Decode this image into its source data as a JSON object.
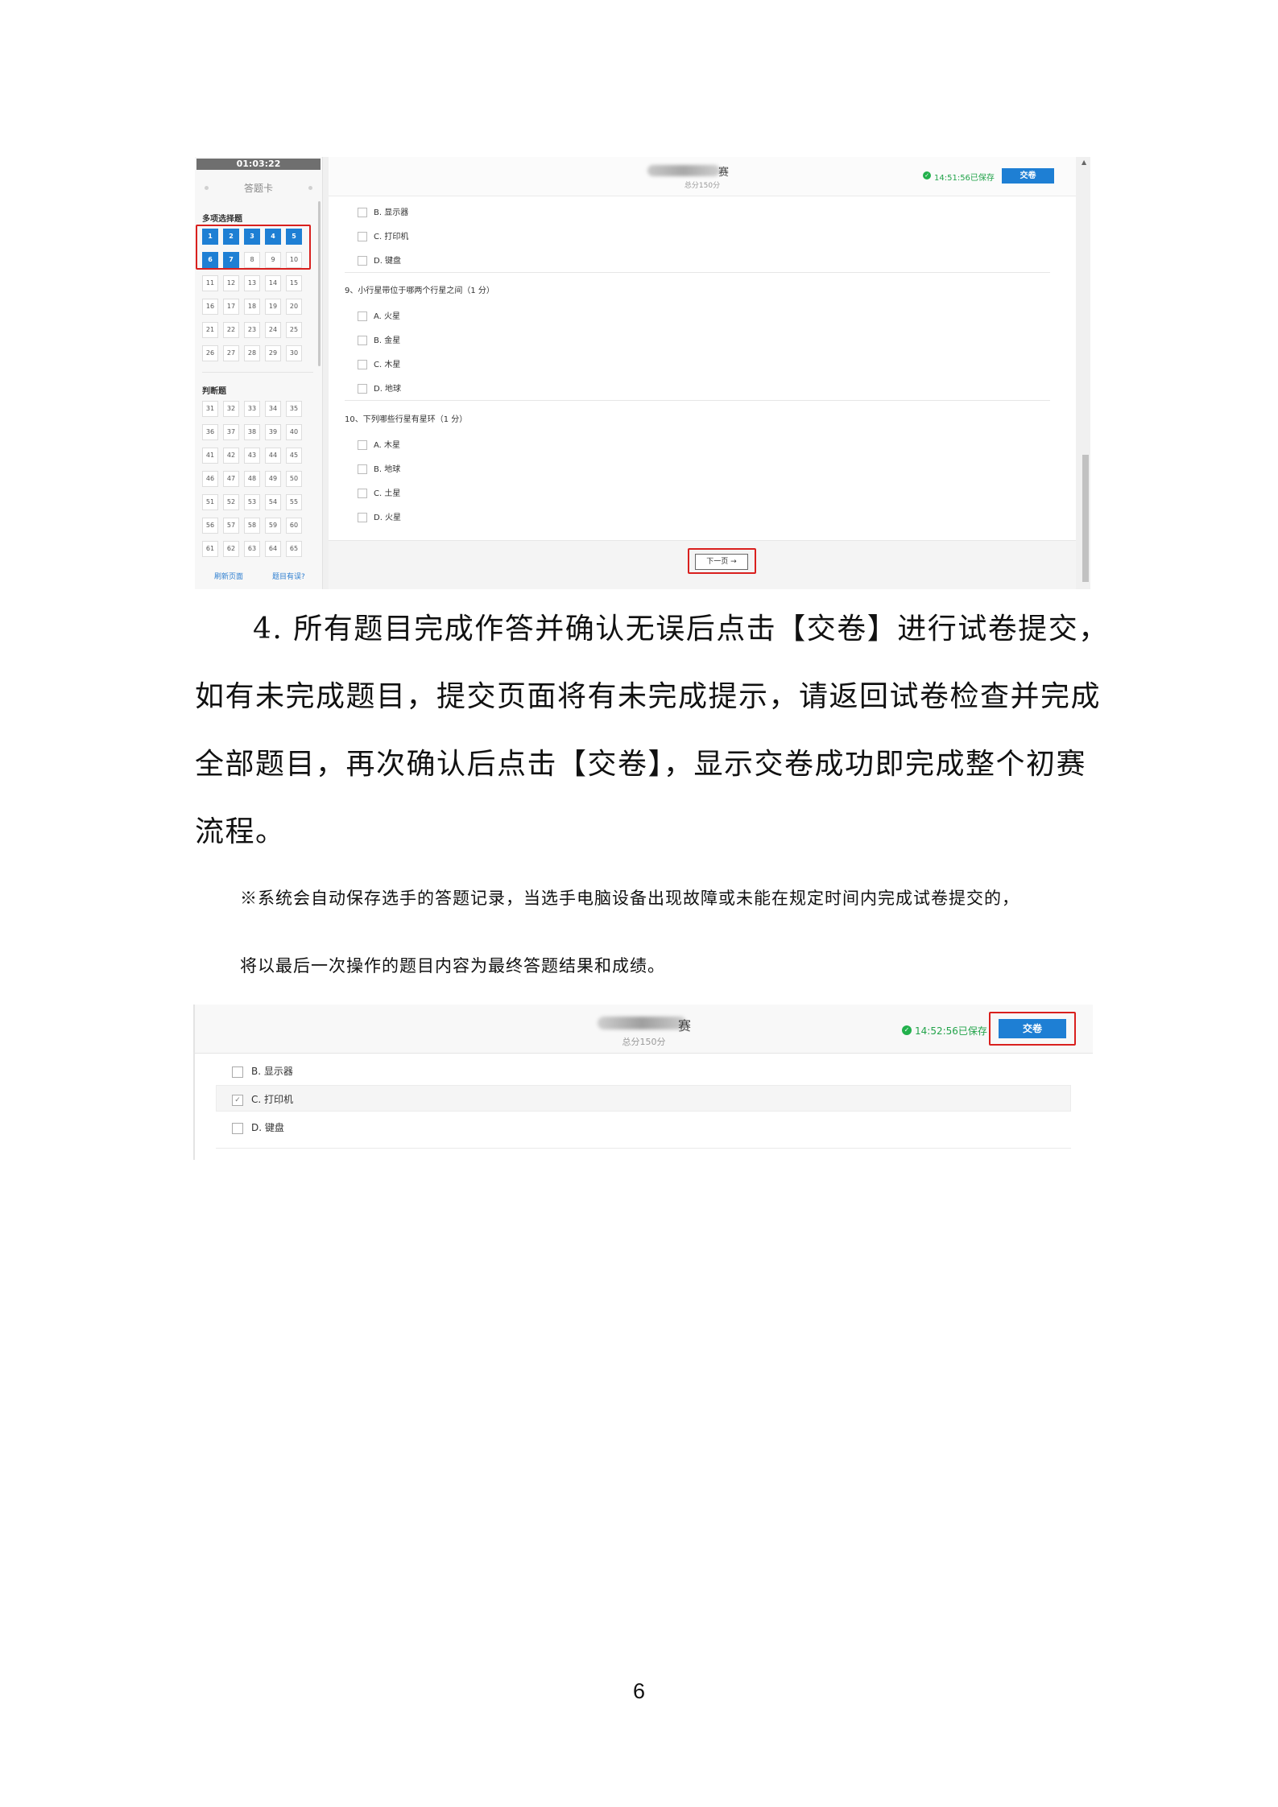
{
  "screenshot1": {
    "timer": "01:03:22",
    "card_title": "答题卡",
    "section_multi": "多项选择题",
    "multi_numbers": [
      "1",
      "2",
      "3",
      "4",
      "5",
      "6",
      "7",
      "8",
      "9",
      "10",
      "11",
      "12",
      "13",
      "14",
      "15",
      "16",
      "17",
      "18",
      "19",
      "20",
      "21",
      "22",
      "23",
      "24",
      "25",
      "26",
      "27",
      "28",
      "29",
      "30"
    ],
    "multi_answered": [
      "1",
      "2",
      "3",
      "4",
      "5",
      "6",
      "7"
    ],
    "section_judge": "判断题",
    "judge_numbers": [
      "31",
      "32",
      "33",
      "34",
      "35",
      "36",
      "37",
      "38",
      "39",
      "40",
      "41",
      "42",
      "43",
      "44",
      "45",
      "46",
      "47",
      "48",
      "49",
      "50",
      "51",
      "52",
      "53",
      "54",
      "55",
      "56",
      "57",
      "58",
      "59",
      "60",
      "61",
      "62",
      "63",
      "64",
      "65"
    ],
    "refresh_link": "刷新页面",
    "error_link": "题目有误?",
    "title_suffix": "赛",
    "total": "总分150分",
    "save_status": "14:51:56已保存",
    "submit": "交卷",
    "q8_options": [
      "B. 显示器",
      "C. 打印机",
      "D. 键盘"
    ],
    "q9_title": "9、小行星带位于哪两个行星之间（1 分）",
    "q9_options": [
      "A. 火星",
      "B. 金星",
      "C. 木星",
      "D. 地球"
    ],
    "q10_title": "10、下列哪些行星有星环（1 分）",
    "q10_options": [
      "A. 木星",
      "B. 地球",
      "C. 土星",
      "D. 火星"
    ],
    "next_button": "下一页 →"
  },
  "body": {
    "para_lines": [
      "4. 所有题目完成作答并确认无误后点击【交卷】进行试卷提交，",
      "如有未完成题目，提交页面将有未完成提示，请返回试卷检查并完成",
      "全部题目，再次确认后点击【交卷】，显示交卷成功即完成整个初赛",
      "流程。"
    ],
    "note_lines": [
      "※系统会自动保存选手的答题记录，当选手电脑设备出现故障或未能在规定时间内完成试卷提交的，",
      "将以最后一次操作的题目内容为最终答题结果和成绩。"
    ]
  },
  "screenshot2": {
    "title_suffix": "赛",
    "total": "总分150分",
    "save_status": "14:52:56已保存",
    "submit": "交卷",
    "options": [
      {
        "label": "B. 显示器",
        "checked": false
      },
      {
        "label": "C. 打印机",
        "checked": true
      },
      {
        "label": "D. 键盘",
        "checked": false
      }
    ]
  },
  "page_number": "6"
}
